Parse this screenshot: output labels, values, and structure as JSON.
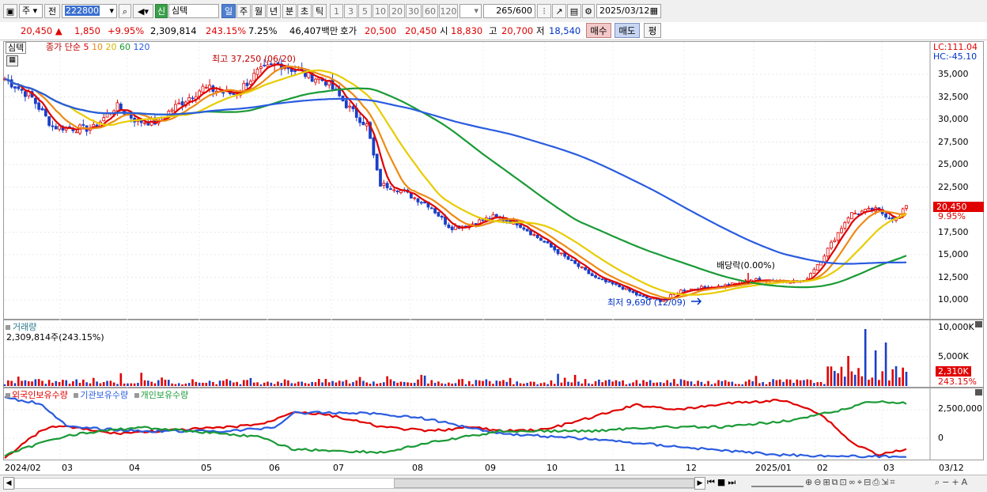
{
  "toolbar": {
    "period_label": "주",
    "prev_label": "전",
    "code": "222800",
    "stock_badge": "신",
    "stock_name": "심텍",
    "period_buttons": [
      "일",
      "주",
      "월",
      "년",
      "분",
      "초",
      "틱"
    ],
    "interval_buttons": [
      "1",
      "3",
      "5",
      "10",
      "20",
      "30",
      "60",
      "120"
    ],
    "bar_count": "265",
    "bar_max": "/600",
    "date": "2025/03/12"
  },
  "quote": {
    "price": "20,450",
    "change": "1,850",
    "change_pct": "+9.95%",
    "volume": "2,309,814",
    "volume_pct": "243.15%",
    "turnover_rate": "7.25%",
    "amount": "46,407백만",
    "ask_label": "호가",
    "ask": "20,500",
    "bid": "20,450",
    "open_label": "시",
    "open": "18,830",
    "high_label": "고",
    "high": "20,700",
    "low_label": "저",
    "low": "18,540",
    "buy_label": "매수",
    "sell_label": "매도",
    "pin_label": "평"
  },
  "legend": {
    "stock": "심텍",
    "ma_label": "종가 단순",
    "ma_periods": [
      "5",
      "10",
      "20",
      "60",
      "120"
    ],
    "ma_colors": [
      "#e00000",
      "#ee8a14",
      "#e8cc00",
      "#1a9a36",
      "#2a5ce0"
    ]
  },
  "annotations": {
    "high": "최고 37,250 (06/20)",
    "low": "최저 9,690 (12/09)",
    "dividend": "배당락(0.00%)"
  },
  "price_axis": {
    "lc": "LC:111.04",
    "hc": "HC:-45.10",
    "ticks": [
      "35,000",
      "32,500",
      "30,000",
      "27,500",
      "25,000",
      "22,500",
      "20,000",
      "17,500",
      "15,000",
      "12,500",
      "10,000"
    ],
    "last_price": "20,450",
    "last_pct": "9.95%"
  },
  "volume_panel": {
    "title": "거래량",
    "value": "2,309,814주(243.15%)",
    "ticks": [
      "10,000K",
      "5,000K"
    ],
    "last": "2,310K",
    "last_pct": "243.15%"
  },
  "holdings_panel": {
    "items": [
      "외국인보유수량",
      "기관보유수량",
      "개인보유수량"
    ],
    "colors": [
      "#e00000",
      "#2a5ce0",
      "#1a9a36"
    ],
    "ticks": [
      "2,500,000",
      "0"
    ]
  },
  "x_axis": {
    "labels": [
      "2024/02",
      "03",
      "04",
      "05",
      "06",
      "07",
      "08",
      "09",
      "10",
      "11",
      "12",
      "2025/01",
      "02",
      "03"
    ],
    "end_date": "03/12"
  }
}
